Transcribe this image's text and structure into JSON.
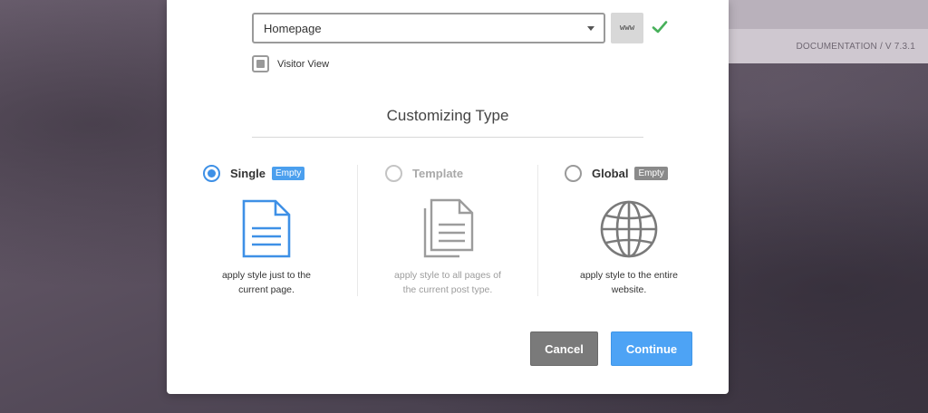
{
  "background": {
    "documentation_link": "DOCUMENTATION / V 7.3.1"
  },
  "page_select": {
    "value": "Homepage",
    "www_button": "www"
  },
  "visitor_view": {
    "label": "Visitor View",
    "checked": true
  },
  "customizing": {
    "title": "Customizing Type",
    "options": [
      {
        "label": "Single",
        "badge": "Empty",
        "state": "selected",
        "icon": "document-icon",
        "description_line1": "apply style just to the",
        "description_line2": "current page."
      },
      {
        "label": "Template",
        "badge": "",
        "state": "disabled",
        "icon": "documents-stack-icon",
        "description_line1": "apply style to all pages of",
        "description_line2": "the current post type."
      },
      {
        "label": "Global",
        "badge": "Empty",
        "state": "unselected",
        "icon": "globe-icon",
        "description_line1": "apply style to the entire",
        "description_line2": "website."
      }
    ]
  },
  "buttons": {
    "cancel": "Cancel",
    "continue": "Continue"
  },
  "colors": {
    "accent": "#4da3f5",
    "selected_radio": "#3e90e6",
    "check": "#47b05a",
    "badge_gray": "#8a8a8a"
  }
}
